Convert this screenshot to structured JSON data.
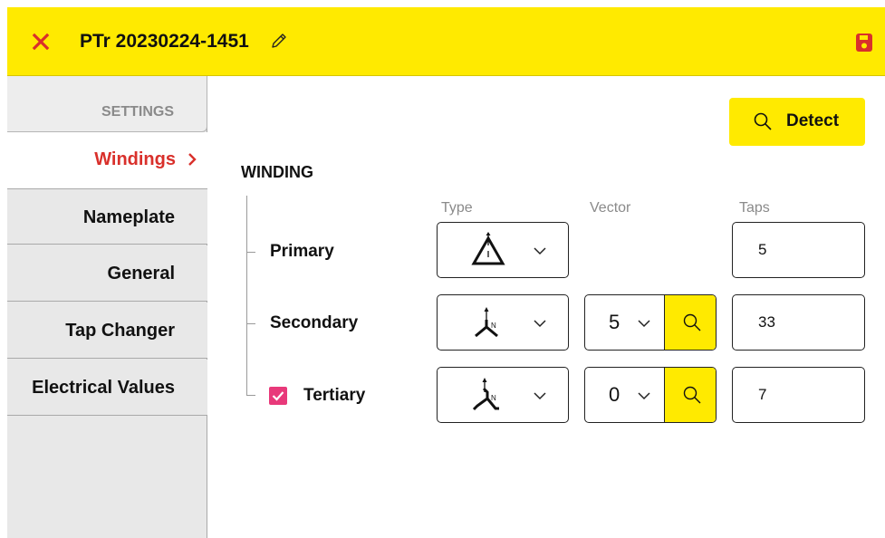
{
  "header": {
    "title": "PTr 20230224-1451"
  },
  "sidebar": {
    "settings_label": "SETTINGS",
    "items": [
      {
        "label": "Windings"
      },
      {
        "label": "Nameplate"
      },
      {
        "label": "General"
      },
      {
        "label": "Tap Changer"
      },
      {
        "label": "Electrical Values"
      }
    ]
  },
  "toolbar": {
    "detect_label": "Detect"
  },
  "winding": {
    "section_title": "WINDING",
    "columns": {
      "type": "Type",
      "vector": "Vector",
      "taps": "Taps"
    },
    "rows": [
      {
        "label": "Primary",
        "type_icon": "delta-triangle-icon",
        "taps": "5"
      },
      {
        "label": "Secondary",
        "type_icon": "wye-neutral-icon",
        "vector": "5",
        "taps": "33"
      },
      {
        "label": "Tertiary",
        "type_icon": "zigzag-neutral-icon",
        "vector": "0",
        "taps": "7",
        "checked": true
      }
    ]
  },
  "colors": {
    "accent_yellow": "#ffea00",
    "active_red": "#d9302b",
    "checkbox_pink": "#e8397a",
    "sidebar_gray": "#e8e8e8"
  }
}
